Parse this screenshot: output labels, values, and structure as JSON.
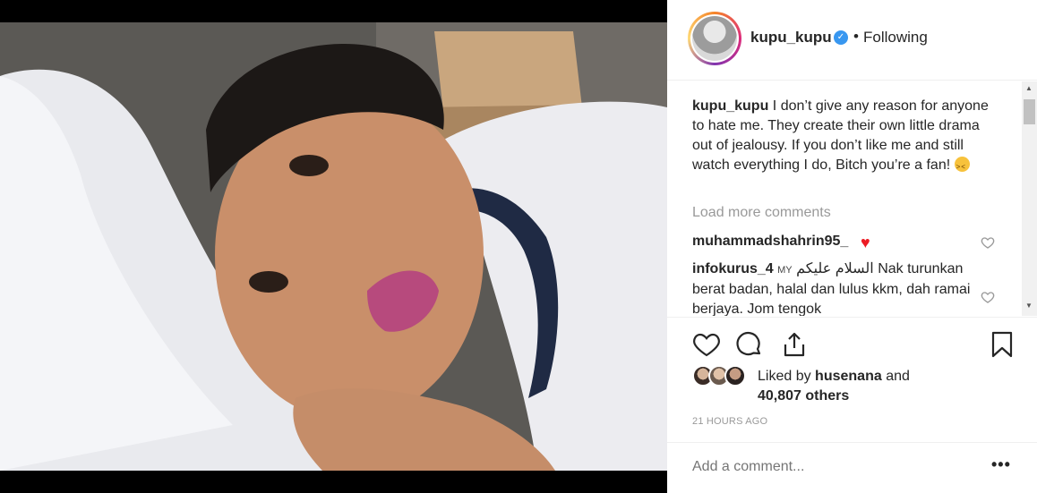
{
  "post": {
    "username": "kupu_kupu",
    "separator": "•",
    "follow_status": "Following",
    "verified_icon": "verified-badge-icon"
  },
  "caption": {
    "username": "kupu_kupu",
    "text": "I don’t give any reason for anyone to hate me. They create their own little drama out of jealousy. If you don’t like me and still watch everything I do, Bitch you’re a fan!"
  },
  "load_more_label": "Load more comments",
  "comments": [
    {
      "username": "muhammadshahrin95_",
      "text": ""
    },
    {
      "username": "infokurus_4",
      "flag": "MY",
      "text": "السلام عليكم Nak turunkan berat badan, halal dan lulus kkm, dah ramai berjaya. Jom tengok"
    }
  ],
  "likes": {
    "prefix": "Liked by",
    "user": "husenana",
    "conjunction": "and",
    "others": "40,807 others"
  },
  "timestamp": "21 HOURS AGO",
  "comment_input": {
    "placeholder": "Add a comment..."
  },
  "more_label": "•••",
  "colors": {
    "verified": "#3897f0",
    "heart": "#ed1c24",
    "muted": "#999999",
    "text": "#262626"
  }
}
